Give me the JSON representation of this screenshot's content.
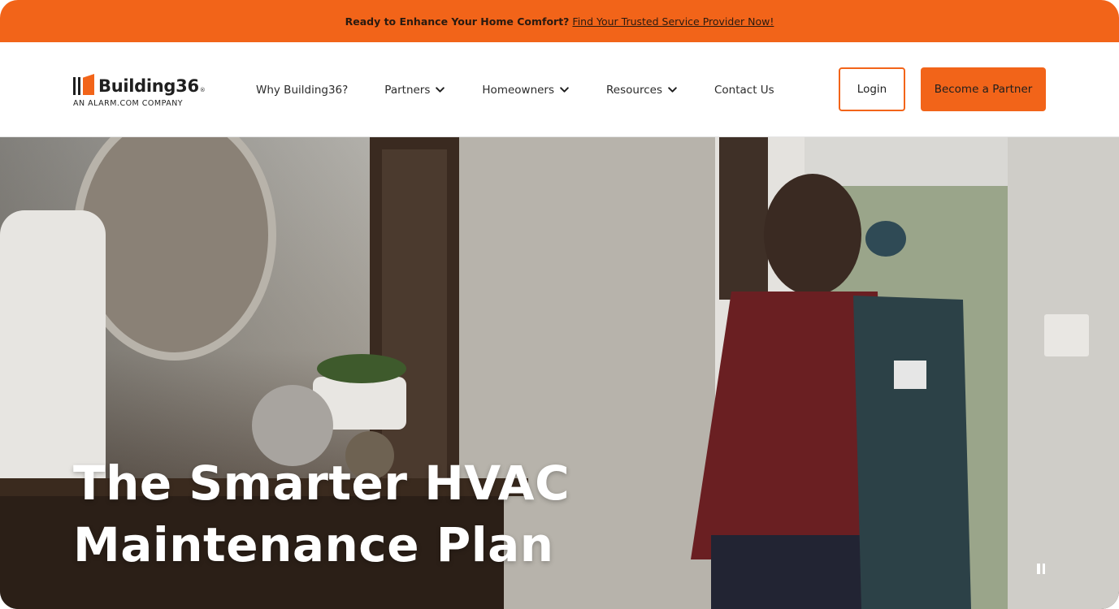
{
  "promo": {
    "lead_text": "Ready to Enhance Your Home Comfort?",
    "link_text": "Find Your Trusted Service Provider Now!"
  },
  "logo": {
    "wordmark": "Building36",
    "registered": "®",
    "tagline": "AN ALARM.COM COMPANY"
  },
  "nav": {
    "items": [
      {
        "label": "Why Building36?",
        "has_dropdown": false
      },
      {
        "label": "Partners",
        "has_dropdown": true
      },
      {
        "label": "Homeowners",
        "has_dropdown": true
      },
      {
        "label": "Resources",
        "has_dropdown": true
      },
      {
        "label": "Contact Us",
        "has_dropdown": false
      }
    ]
  },
  "actions": {
    "login_label": "Login",
    "partner_label": "Become a Partner"
  },
  "hero": {
    "title_line1": "The Smarter HVAC",
    "title_line2": "Maintenance Plan",
    "media_control_icon": "pause-icon"
  },
  "colors": {
    "brand_orange": "#f26419",
    "text_dark": "#1f1f1f",
    "hero_text": "#ffffff"
  }
}
